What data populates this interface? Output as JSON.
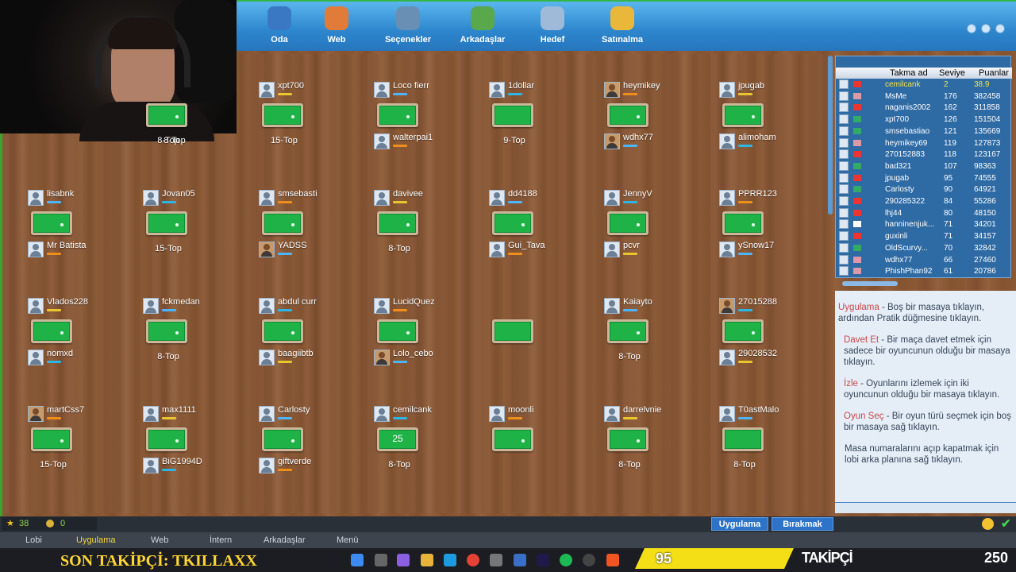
{
  "toolbar": {
    "items": [
      {
        "label": "Oda",
        "icon": "room-icon"
      },
      {
        "label": "Web",
        "icon": "web-icon"
      },
      {
        "label": "Seçenekler",
        "icon": "gear-icon"
      },
      {
        "label": "Arkadaşlar",
        "icon": "friends-icon"
      },
      {
        "label": "Hedef",
        "icon": "target-icon"
      },
      {
        "label": "Satınalma",
        "icon": "purchase-icon"
      }
    ]
  },
  "tables": [
    {
      "top": "",
      "bottom": "",
      "label": "8-Top"
    },
    {
      "top": "xpt700",
      "bottom": "",
      "label": "15-Top"
    },
    {
      "top": "Loco fierr",
      "bottom": "walterpai1",
      "label": ""
    },
    {
      "top": "1dollar",
      "bottom": "",
      "label": "9-Top"
    },
    {
      "top": "heymikey",
      "bottom": "wdhx77",
      "label": ""
    },
    {
      "top": "jpugab",
      "bottom": "alimoham",
      "label": ""
    },
    {
      "top": "lisabnk",
      "bottom": "Mr Batista",
      "label": ""
    },
    {
      "top": "Jovan05",
      "bottom": "",
      "label": "15-Top"
    },
    {
      "top": "smsebasti",
      "bottom": "YADSS",
      "label": ""
    },
    {
      "top": "davivee",
      "bottom": "",
      "label": "8-Top"
    },
    {
      "top": "dd4188",
      "bottom": "Gui_Tava",
      "label": ""
    },
    {
      "top": "JennyV",
      "bottom": "pcvr",
      "label": ""
    },
    {
      "top": "PPRR123",
      "bottom": "ySnow17",
      "label": ""
    },
    {
      "top": "Vlados228",
      "bottom": "nomxd",
      "label": ""
    },
    {
      "top": "fckmedan",
      "bottom": "",
      "label": "8-Top"
    },
    {
      "top": "abdul curr",
      "bottom": "baagiibtb",
      "label": ""
    },
    {
      "top": "LucidQuez",
      "bottom": "Lolo_cebo",
      "label": ""
    },
    {
      "top": "",
      "bottom": "",
      "label": ""
    },
    {
      "top": "Kaiayto",
      "bottom": "",
      "label": "8-Top"
    },
    {
      "top": "27015288",
      "bottom": "29028532",
      "label": ""
    },
    {
      "top": "martCss7",
      "bottom": "",
      "label": "15-Top"
    },
    {
      "top": "max1111",
      "bottom": "BiG1994D",
      "label": ""
    },
    {
      "top": "Carlosty",
      "bottom": "giftverde",
      "label": ""
    },
    {
      "top": "cemilcank",
      "bottom": "",
      "label": "8-Top",
      "num": "25"
    },
    {
      "top": "moonli",
      "bottom": "",
      "label": ""
    },
    {
      "top": "darrelvnie",
      "bottom": "",
      "label": "8-Top"
    },
    {
      "top": "T0astMalo",
      "bottom": "",
      "label": "8-Top"
    }
  ],
  "ranking": {
    "columns": [
      "Takma ad",
      "Seviye",
      "Puanlar"
    ],
    "rows": [
      {
        "name": "cemilcank",
        "level": "2",
        "points": "38.9",
        "highlight": true,
        "flag": "#e33"
      },
      {
        "name": "MsMe",
        "level": "176",
        "points": "382458",
        "flag": "#d9a"
      },
      {
        "name": "naganis2002",
        "level": "162",
        "points": "311858",
        "flag": "#e33"
      },
      {
        "name": "xpt700",
        "level": "126",
        "points": "151504",
        "flag": "#3a6"
      },
      {
        "name": "smsebastiao",
        "level": "121",
        "points": "135669",
        "flag": "#3a6"
      },
      {
        "name": "heymikey69",
        "level": "119",
        "points": "127873",
        "flag": "#d9a"
      },
      {
        "name": "270152883",
        "level": "118",
        "points": "123167",
        "flag": "#e33"
      },
      {
        "name": "bad321",
        "level": "107",
        "points": "98363",
        "flag": "#3a6"
      },
      {
        "name": "jpugab",
        "level": "95",
        "points": "74555",
        "flag": "#e33"
      },
      {
        "name": "Carlosty",
        "level": "90",
        "points": "64921",
        "flag": "#3a6"
      },
      {
        "name": "290285322",
        "level": "84",
        "points": "55286",
        "flag": "#e33"
      },
      {
        "name": "lhj44",
        "level": "80",
        "points": "48150",
        "flag": "#e33"
      },
      {
        "name": "hanninenjuk...",
        "level": "71",
        "points": "34201",
        "flag": "#fff"
      },
      {
        "name": "guxinli",
        "level": "71",
        "points": "34157",
        "flag": "#e33"
      },
      {
        "name": "OldScurvy...",
        "level": "70",
        "points": "32842",
        "flag": "#3a6"
      },
      {
        "name": "wdhx77",
        "level": "66",
        "points": "27460",
        "flag": "#d9a"
      },
      {
        "name": "PhishPhan92",
        "level": "61",
        "points": "20786",
        "flag": "#d9a"
      }
    ]
  },
  "help": [
    {
      "title": "Uygulama",
      "text": " - Boş bir masaya tıklayın, ardından Pratik düğmesine tıklayın."
    },
    {
      "title": "Davet Et",
      "text": " - Bir maça davet etmek için sadece bir oyuncunun olduğu bir masaya tıklayın."
    },
    {
      "title": "İzle",
      "text": " - Oyunlarını izlemek için iki oyuncunun olduğu bir masaya tıklayın."
    },
    {
      "title": "Oyun Seç",
      "text": " - Bir oyun türü seçmek için boş bir masaya sağ tıklayın."
    },
    {
      "title": "",
      "text": "Masa numaralarını açıp kapatmak için lobi arka planına sağ tıklayın."
    }
  ],
  "status": {
    "stars": "38",
    "coins": "0",
    "practice_btn": "Uygulama",
    "leave_btn": "Bırakmak"
  },
  "nav": [
    "Lobi",
    "Uygulama",
    "Web",
    "İntern",
    "Arkadaşlar",
    "Menü"
  ],
  "stream": {
    "follower_text": "SON TAKİPÇİ: TKILLAXX",
    "count": "95",
    "label": "TAKİPÇİ",
    "goal": "250"
  }
}
